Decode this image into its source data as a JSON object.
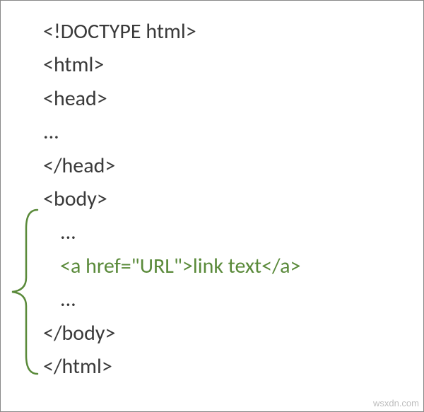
{
  "code": {
    "line1": "<!DOCTYPE html>",
    "line2": "<html>",
    "line3": "<head>",
    "line4": "...",
    "line5": "</head>",
    "line6": "<body>",
    "line7": "...",
    "line8": "<a href=\"URL\">link text</a>",
    "line9": "...",
    "line10": "</body>",
    "line11": "</html>"
  },
  "brace_color": "#5a8a3a",
  "watermark": "wsxdn.com"
}
